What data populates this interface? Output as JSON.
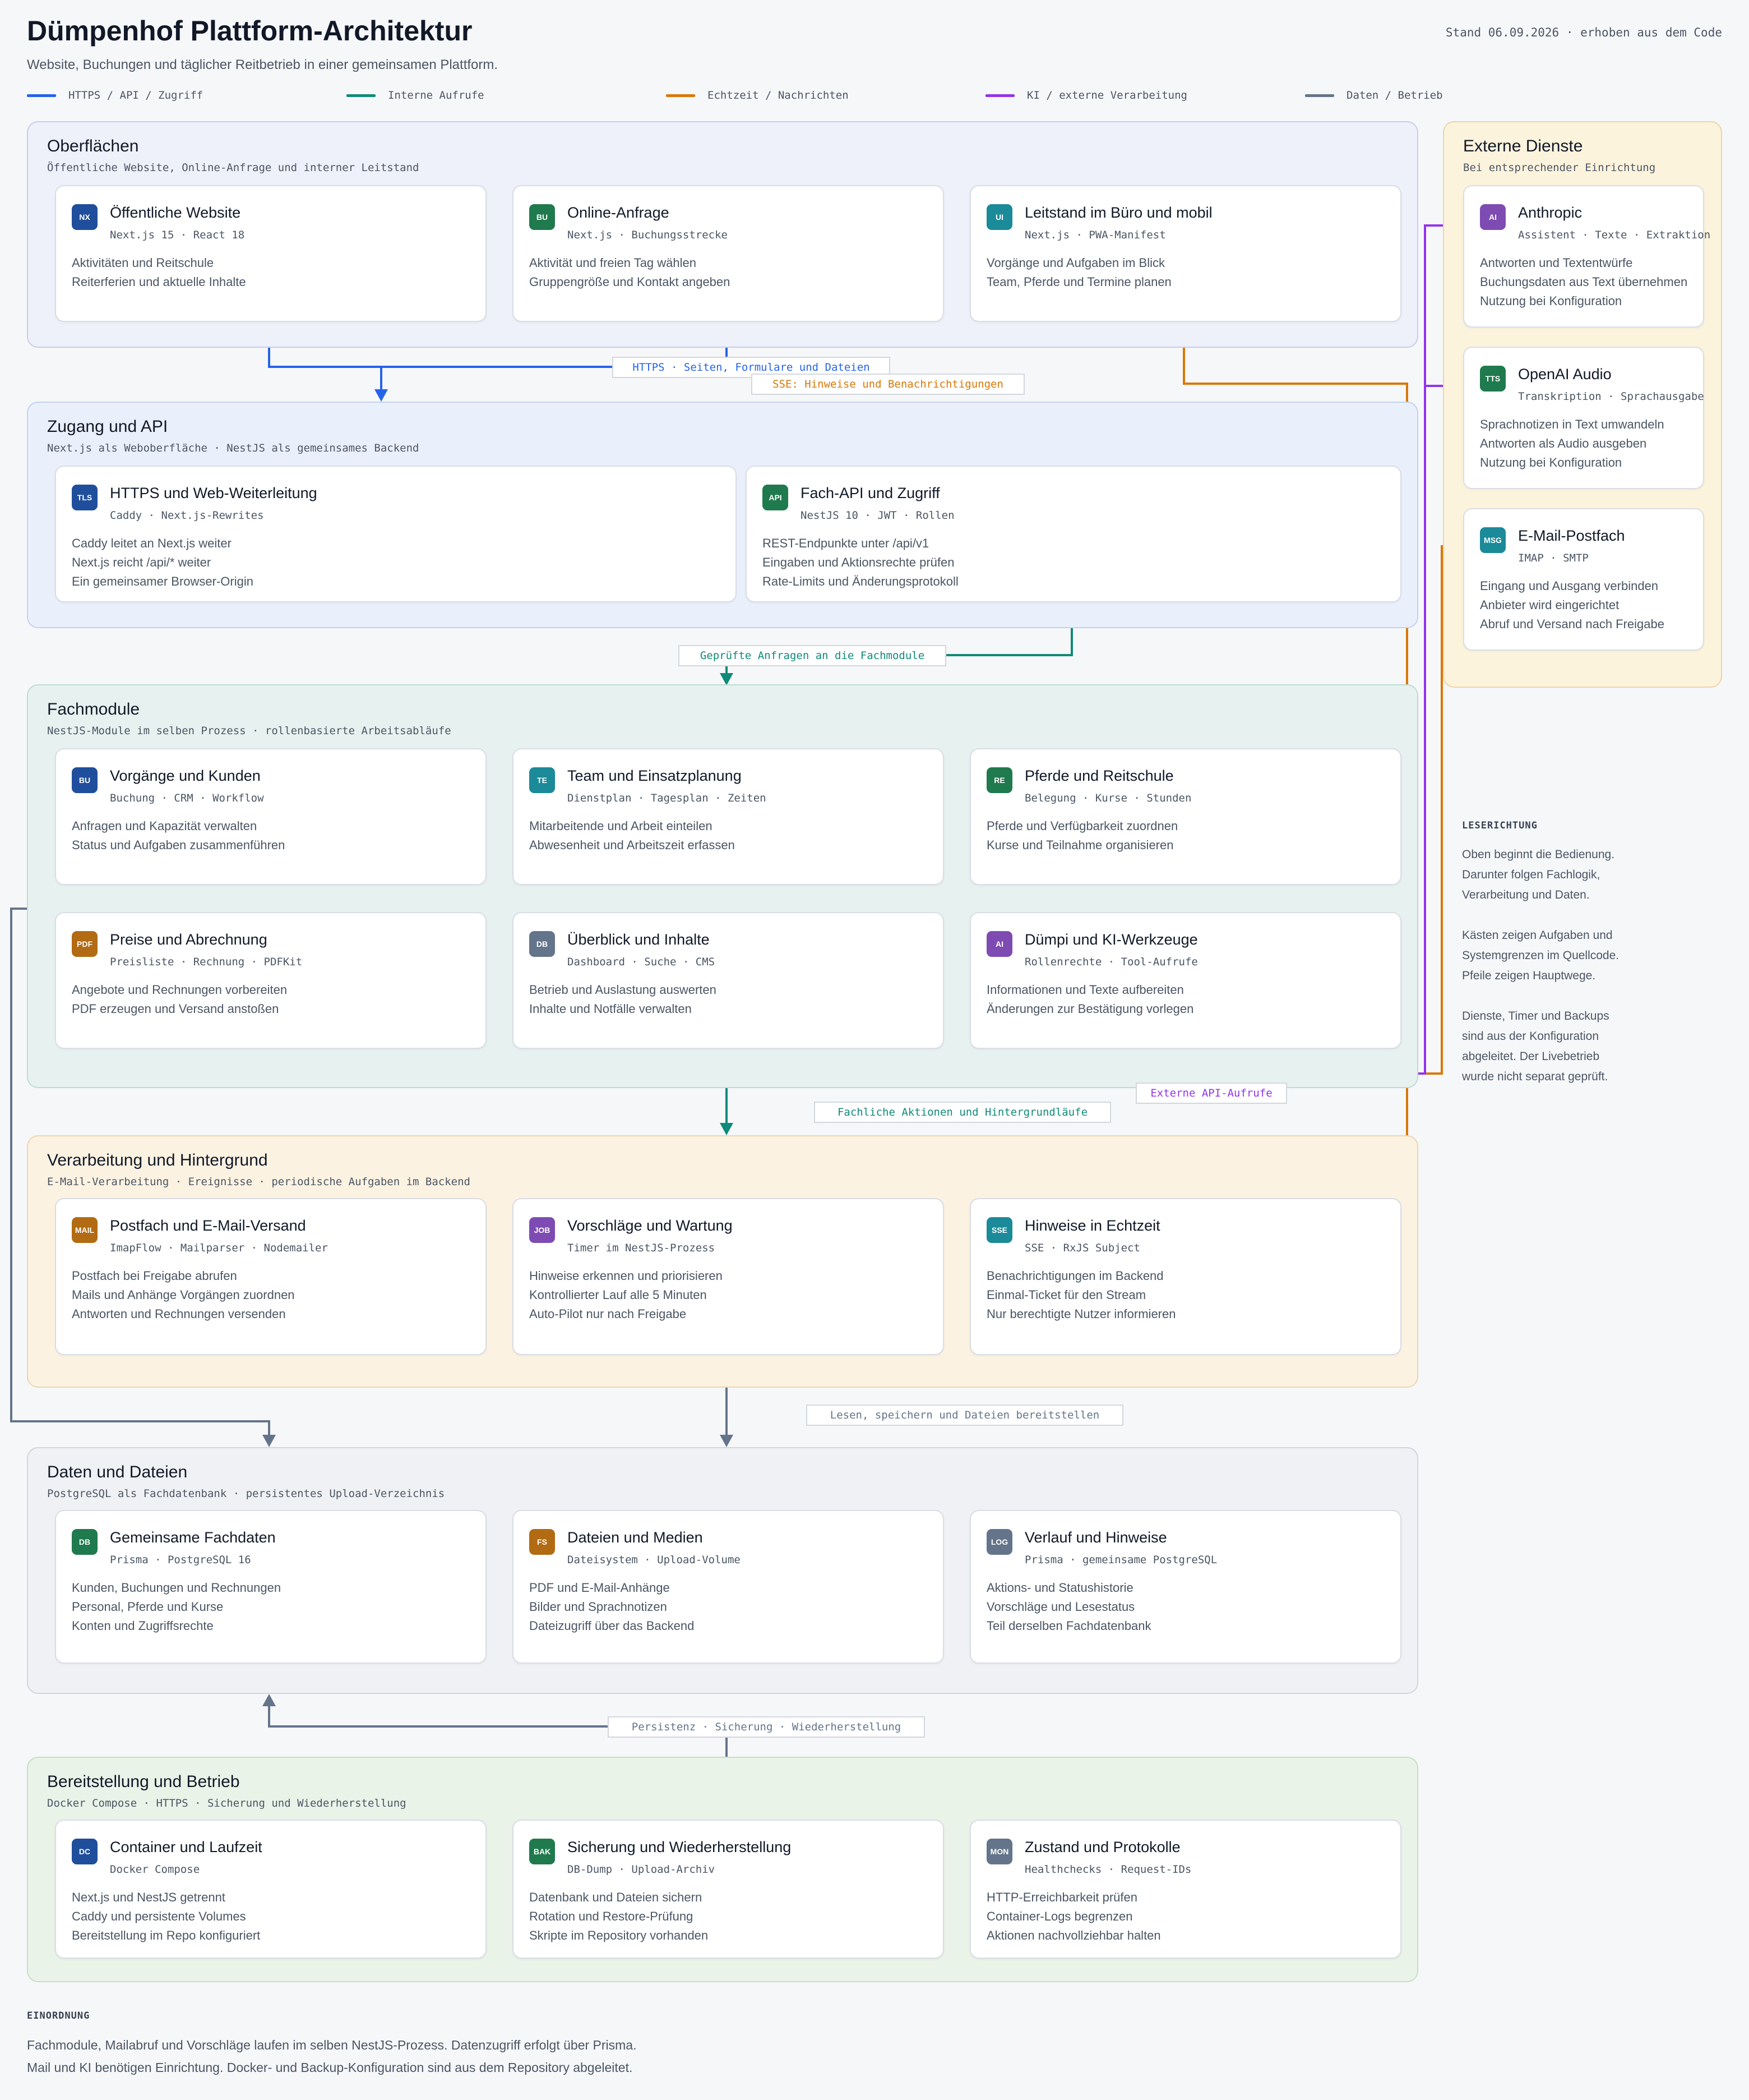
{
  "header": {
    "title": "Dümpenhof Plattform-Architektur",
    "subtitle": "Website, Buchungen und täglicher Reitbetrieb in einer gemeinsamen Plattform.",
    "stand": "Stand 06.09.2026 · erhoben aus dem Code"
  },
  "legend": [
    {
      "label": "HTTPS / API / Zugriff",
      "color": "#2563eb"
    },
    {
      "label": "Interne Aufrufe",
      "color": "#0f8a78"
    },
    {
      "label": "Echtzeit / Nachrichten",
      "color": "#d97706"
    },
    {
      "label": "KI / externe Verarbeitung",
      "color": "#9333ea"
    },
    {
      "label": "Daten / Betrieb",
      "color": "#64748b"
    }
  ],
  "colors": {
    "blue": "#2563eb",
    "teal": "#0f8a78",
    "orange": "#d97706",
    "purple": "#9333ea",
    "slate": "#64748b"
  },
  "sections": {
    "oberflaechen": {
      "title": "Oberflächen",
      "subtitle": "Öffentliche Website, Online-Anfrage und interner Leitstand",
      "cards": [
        {
          "badge": "NX",
          "badge_color": "#1f4e9c",
          "title": "Öffentliche Website",
          "tech": "Next.js 15 · React 18",
          "lines": [
            "Aktivitäten und Reitschule",
            "Reiterferien und aktuelle Inhalte"
          ]
        },
        {
          "badge": "BU",
          "badge_color": "#1f7a4d",
          "title": "Online-Anfrage",
          "tech": "Next.js · Buchungsstrecke",
          "lines": [
            "Aktivität und freien Tag wählen",
            "Gruppengröße und Kontakt angeben"
          ]
        },
        {
          "badge": "UI",
          "badge_color": "#1b8a99",
          "title": "Leitstand im Büro und mobil",
          "tech": "Next.js · PWA-Manifest",
          "lines": [
            "Vorgänge und Aufgaben im Blick",
            "Team, Pferde und Termine planen"
          ]
        }
      ]
    },
    "zugang": {
      "title": "Zugang und API",
      "subtitle": "Next.js als Weboberfläche · NestJS als gemeinsames Backend",
      "cards": [
        {
          "badge": "TLS",
          "badge_color": "#1f4e9c",
          "title": "HTTPS und Web-Weiterleitung",
          "tech": "Caddy · Next.js-Rewrites",
          "lines": [
            "Caddy leitet an Next.js weiter",
            "Next.js reicht /api/* weiter",
            "Ein gemeinsamer Browser-Origin"
          ]
        },
        {
          "badge": "API",
          "badge_color": "#1f7a4d",
          "title": "Fach-API und Zugriff",
          "tech": "NestJS 10 · JWT · Rollen",
          "lines": [
            "REST-Endpunkte unter /api/v1",
            "Eingaben und Aktionsrechte prüfen",
            "Rate-Limits und Änderungsprotokoll"
          ]
        }
      ]
    },
    "fachmodule": {
      "title": "Fachmodule",
      "subtitle": "NestJS-Module im selben Prozess · rollenbasierte Arbeitsabläufe",
      "cards": [
        {
          "badge": "BU",
          "badge_color": "#1f4e9c",
          "title": "Vorgänge und Kunden",
          "tech": "Buchung · CRM · Workflow",
          "lines": [
            "Anfragen und Kapazität verwalten",
            "Status und Aufgaben zusammenführen"
          ]
        },
        {
          "badge": "TE",
          "badge_color": "#1b8a99",
          "title": "Team und Einsatzplanung",
          "tech": "Dienstplan · Tagesplan · Zeiten",
          "lines": [
            "Mitarbeitende und Arbeit einteilen",
            "Abwesenheit und Arbeitszeit erfassen"
          ]
        },
        {
          "badge": "RE",
          "badge_color": "#1f7a4d",
          "title": "Pferde und Reitschule",
          "tech": "Belegung · Kurse · Stunden",
          "lines": [
            "Pferde und Verfügbarkeit zuordnen",
            "Kurse und Teilnahme organisieren"
          ]
        },
        {
          "badge": "PDF",
          "badge_color": "#b26b12",
          "title": "Preise und Abrechnung",
          "tech": "Preisliste · Rechnung · PDFKit",
          "lines": [
            "Angebote und Rechnungen vorbereiten",
            "PDF erzeugen und Versand anstoßen"
          ]
        },
        {
          "badge": "DB",
          "badge_color": "#64748b",
          "title": "Überblick und Inhalte",
          "tech": "Dashboard · Suche · CMS",
          "lines": [
            "Betrieb und Auslastung auswerten",
            "Inhalte und Notfälle verwalten"
          ]
        },
        {
          "badge": "AI",
          "badge_color": "#7e4bb3",
          "title": "Dümpi und KI-Werkzeuge",
          "tech": "Rollenrechte · Tool-Aufrufe",
          "lines": [
            "Informationen und Texte aufbereiten",
            "Änderungen zur Bestätigung vorlegen"
          ]
        }
      ]
    },
    "verarbeitung": {
      "title": "Verarbeitung und Hintergrund",
      "subtitle": "E-Mail-Verarbeitung · Ereignisse · periodische Aufgaben im Backend",
      "cards": [
        {
          "badge": "MAIL",
          "badge_color": "#b26b12",
          "title": "Postfach und E-Mail-Versand",
          "tech": "ImapFlow · Mailparser · Nodemailer",
          "lines": [
            "Postfach bei Freigabe abrufen",
            "Mails und Anhänge Vorgängen zuordnen",
            "Antworten und Rechnungen versenden"
          ]
        },
        {
          "badge": "JOB",
          "badge_color": "#7e4bb3",
          "title": "Vorschläge und Wartung",
          "tech": "Timer im NestJS-Prozess",
          "lines": [
            "Hinweise erkennen und priorisieren",
            "Kontrollierter Lauf alle 5 Minuten",
            "Auto-Pilot nur nach Freigabe"
          ]
        },
        {
          "badge": "SSE",
          "badge_color": "#1b8a99",
          "title": "Hinweise in Echtzeit",
          "tech": "SSE · RxJS Subject",
          "lines": [
            "Benachrichtigungen im Backend",
            "Einmal-Ticket für den Stream",
            "Nur berechtigte Nutzer informieren"
          ]
        }
      ]
    },
    "daten": {
      "title": "Daten und Dateien",
      "subtitle": "PostgreSQL als Fachdatenbank · persistentes Upload-Verzeichnis",
      "cards": [
        {
          "badge": "DB",
          "badge_color": "#1f7a4d",
          "title": "Gemeinsame Fachdaten",
          "tech": "Prisma · PostgreSQL 16",
          "lines": [
            "Kunden, Buchungen und Rechnungen",
            "Personal, Pferde und Kurse",
            "Konten und Zugriffsrechte"
          ]
        },
        {
          "badge": "FS",
          "badge_color": "#b26b12",
          "title": "Dateien und Medien",
          "tech": "Dateisystem · Upload-Volume",
          "lines": [
            "PDF und E-Mail-Anhänge",
            "Bilder und Sprachnotizen",
            "Dateizugriff über das Backend"
          ]
        },
        {
          "badge": "LOG",
          "badge_color": "#64748b",
          "title": "Verlauf und Hinweise",
          "tech": "Prisma · gemeinsame PostgreSQL",
          "lines": [
            "Aktions- und Statushistorie",
            "Vorschläge und Lesestatus",
            "Teil derselben Fachdatenbank"
          ]
        }
      ]
    },
    "betrieb": {
      "title": "Bereitstellung und Betrieb",
      "subtitle": "Docker Compose · HTTPS · Sicherung und Wiederherstellung",
      "cards": [
        {
          "badge": "DC",
          "badge_color": "#1f4e9c",
          "title": "Container und Laufzeit",
          "tech": "Docker Compose",
          "lines": [
            "Next.js und NestJS getrennt",
            "Caddy und persistente Volumes",
            "Bereitstellung im Repo konfiguriert"
          ]
        },
        {
          "badge": "BAK",
          "badge_color": "#1f7a4d",
          "title": "Sicherung und Wiederherstellung",
          "tech": "DB-Dump · Upload-Archiv",
          "lines": [
            "Datenbank und Dateien sichern",
            "Rotation und Restore-Prüfung",
            "Skripte im Repository vorhanden"
          ]
        },
        {
          "badge": "MON",
          "badge_color": "#64748b",
          "title": "Zustand und Protokolle",
          "tech": "Healthchecks · Request-IDs",
          "lines": [
            "HTTP-Erreichbarkeit prüfen",
            "Container-Logs begrenzen",
            "Aktionen nachvollziehbar halten"
          ]
        }
      ]
    },
    "extern": {
      "title": "Externe Dienste",
      "subtitle": "Bei entsprechender Einrichtung",
      "cards": [
        {
          "badge": "AI",
          "badge_color": "#7e4bb3",
          "title": "Anthropic",
          "tech": "Assistent · Texte · Extraktion",
          "lines": [
            "Antworten und Textentwürfe",
            "Buchungsdaten aus Text übernehmen",
            "Nutzung bei Konfiguration"
          ]
        },
        {
          "badge": "TTS",
          "badge_color": "#1f7a4d",
          "title": "OpenAI Audio",
          "tech": "Transkription · Sprachausgabe",
          "lines": [
            "Sprachnotizen in Text umwandeln",
            "Antworten als Audio ausgeben",
            "Nutzung bei Konfiguration"
          ]
        },
        {
          "badge": "MSG",
          "badge_color": "#1b8a99",
          "title": "E-Mail-Postfach",
          "tech": "IMAP · SMTP",
          "lines": [
            "Eingang und Ausgang verbinden",
            "Anbieter wird eingerichtet",
            "Abruf und Versand nach Freigabe"
          ]
        }
      ]
    }
  },
  "connectors": {
    "https": "HTTPS · Seiten, Formulare und Dateien",
    "sse": "SSE: Hinweise und Benachrichtigungen",
    "gepruefte": "Geprüfte Anfragen an die Fachmodule",
    "externe": "Externe API-Aufrufe",
    "fachliche": "Fachliche Aktionen und Hintergrundläufe",
    "lesen": "Lesen, speichern und Dateien bereitstellen",
    "persistenz": "Persistenz · Sicherung · Wiederherstellung"
  },
  "leserichtung": {
    "heading": "LESERICHTUNG",
    "p1": [
      "Oben beginnt die Bedienung.",
      "Darunter folgen Fachlogik,",
      "Verarbeitung und Daten."
    ],
    "p2": [
      "Kästen zeigen Aufgaben und",
      "Systemgrenzen im Quellcode.",
      "Pfeile zeigen Hauptwege."
    ],
    "p3": [
      "Dienste, Timer und Backups",
      "sind aus der Konfiguration",
      "abgeleitet. Der Livebetrieb",
      "wurde nicht separat geprüft."
    ]
  },
  "einordnung": {
    "heading": "EINORDNUNG",
    "lines": [
      "Fachmodule, Mailabruf und Vorschläge laufen im selben NestJS-Prozess. Datenzugriff erfolgt über Prisma.",
      "Mail und KI benötigen Einrichtung. Docker- und Backup-Konfiguration sind aus dem Repository abgeleitet."
    ]
  }
}
